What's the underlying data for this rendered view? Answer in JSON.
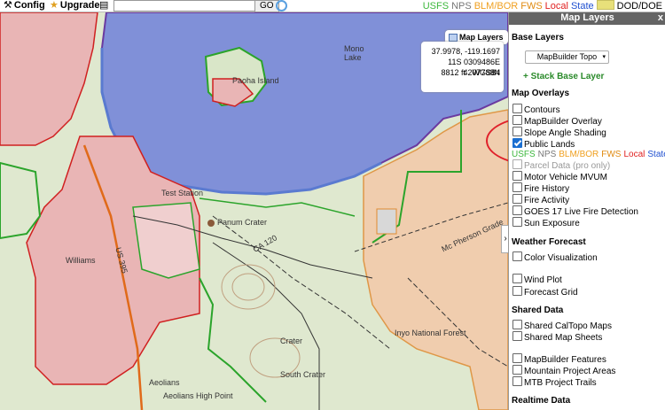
{
  "toolbar": {
    "config_label": "Config",
    "upgrade_label": "Upgrade",
    "search_value": "",
    "go_label": "GO",
    "legend": [
      {
        "label": "USFS",
        "color": "#3db83d"
      },
      {
        "label": "NPS",
        "color": "#777777"
      },
      {
        "label": "BLM/BOR",
        "color": "#f0a020"
      },
      {
        "label": "FWS",
        "color": "#e08a10"
      },
      {
        "label": "Local",
        "color": "#e02020"
      },
      {
        "label": "State",
        "color": "#2050d0"
      }
    ],
    "dod_label": "DOD/DOE"
  },
  "map": {
    "coords": {
      "latlon": "37.9978, -119.1697",
      "utm": "11S 0309486E 4207788N",
      "elevation": "8812 ft",
      "datum": "WGS84"
    },
    "map_layers_button": "Map Layers",
    "labels": {
      "mono_lake": "Mono\nLake",
      "paoha_island": "Paoha Island",
      "test_station": "Test Station",
      "panum_crater": "Panum Crater",
      "ca120": "CA 120",
      "mc_pherson": "Mc Pherson Grade",
      "us395": "US 395",
      "williams": "Williams",
      "crater": "Crater",
      "south_crater": "South Crater",
      "inyo": "Inyo National Forest",
      "aeolians": "Aeolians",
      "high_point": "Aeolians High Point"
    }
  },
  "panel": {
    "title": "Map Layers",
    "close": "x",
    "base_layers_title": "Base Layers",
    "basemap_selected": "MapBuilder Topo",
    "stack_base": "+ Stack Base Layer",
    "overlays_title": "Map Overlays",
    "overlays": [
      {
        "label": "Contours",
        "checked": false
      },
      {
        "label": "MapBuilder Overlay",
        "checked": false
      },
      {
        "label": "Slope Angle Shading",
        "checked": false
      },
      {
        "label": "Public Lands",
        "checked": true
      }
    ],
    "parcel_label": "Parcel Data (pro only)",
    "overlays2": [
      {
        "label": "Motor Vehicle MVUM",
        "checked": false
      },
      {
        "label": "Fire History",
        "checked": false
      },
      {
        "label": "Fire Activity",
        "checked": false
      },
      {
        "label": "GOES 17 Live Fire Detection",
        "checked": false
      },
      {
        "label": "Sun Exposure",
        "checked": false
      }
    ],
    "weather_title": "Weather Forecast",
    "weather": [
      {
        "label": "Color Visualization",
        "checked": false
      },
      {
        "label": "Wind Plot",
        "checked": false
      },
      {
        "label": "Forecast Grid",
        "checked": false
      }
    ],
    "shared_title": "Shared Data",
    "shared": [
      {
        "label": "Shared CalTopo Maps",
        "checked": false
      },
      {
        "label": "Shared Map Sheets",
        "checked": false
      }
    ],
    "features": [
      {
        "label": "MapBuilder Features",
        "checked": false
      },
      {
        "label": "Mountain Project Areas",
        "checked": false
      },
      {
        "label": "MTB Project Trails",
        "checked": false
      }
    ],
    "realtime_title": "Realtime Data"
  }
}
